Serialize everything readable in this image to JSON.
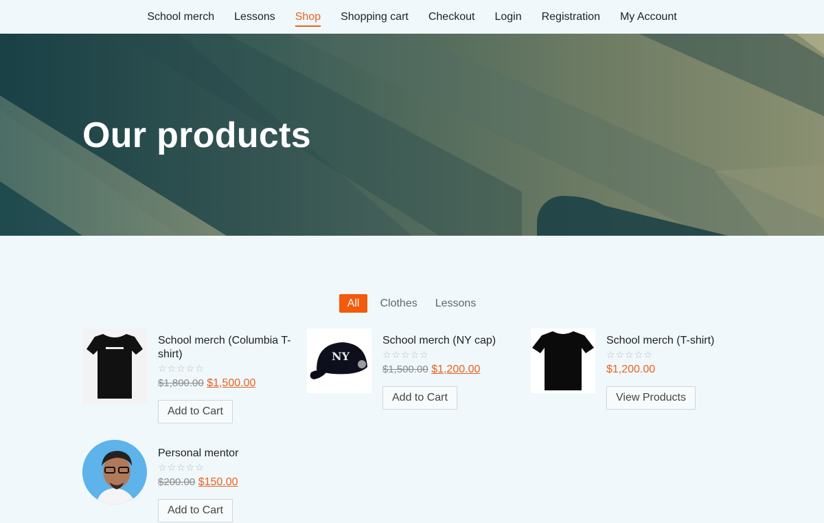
{
  "nav": {
    "items": [
      {
        "label": "School merch",
        "active": false
      },
      {
        "label": "Lessons",
        "active": false
      },
      {
        "label": "Shop",
        "active": true
      },
      {
        "label": "Shopping cart",
        "active": false
      },
      {
        "label": "Checkout",
        "active": false
      },
      {
        "label": "Login",
        "active": false
      },
      {
        "label": "Registration",
        "active": false
      },
      {
        "label": "My Account",
        "active": false
      }
    ]
  },
  "hero": {
    "title": "Our products"
  },
  "filters": {
    "items": [
      {
        "label": "All",
        "active": true
      },
      {
        "label": "Clothes",
        "active": false
      },
      {
        "label": "Lessons",
        "active": false
      }
    ]
  },
  "products": [
    {
      "name": "School merch (Columbia T-shirt)",
      "stars": "☆☆☆☆☆",
      "old_price": "$1,800.00",
      "price": "$1,500.00",
      "button": "Add to Cart",
      "image": "black-tshirt-columbia"
    },
    {
      "name": "School merch (NY cap)",
      "stars": "☆☆☆☆☆",
      "old_price": "$1,500.00",
      "price": "$1,200.00",
      "button": "Add to Cart",
      "image": "ny-cap"
    },
    {
      "name": "School merch (T-shirt)",
      "stars": "☆☆☆☆☆",
      "old_price": "",
      "price": "$1,200.00",
      "button": "View Products",
      "image": "black-tshirt"
    },
    {
      "name": "Personal mentor",
      "stars": "☆☆☆☆☆",
      "old_price": "$200.00",
      "price": "$150.00",
      "button": "Add to Cart",
      "image": "mentor-avatar"
    }
  ],
  "colors": {
    "accent": "#e8621f",
    "filter_active": "#f25a0c",
    "background": "#f0f8fb"
  }
}
